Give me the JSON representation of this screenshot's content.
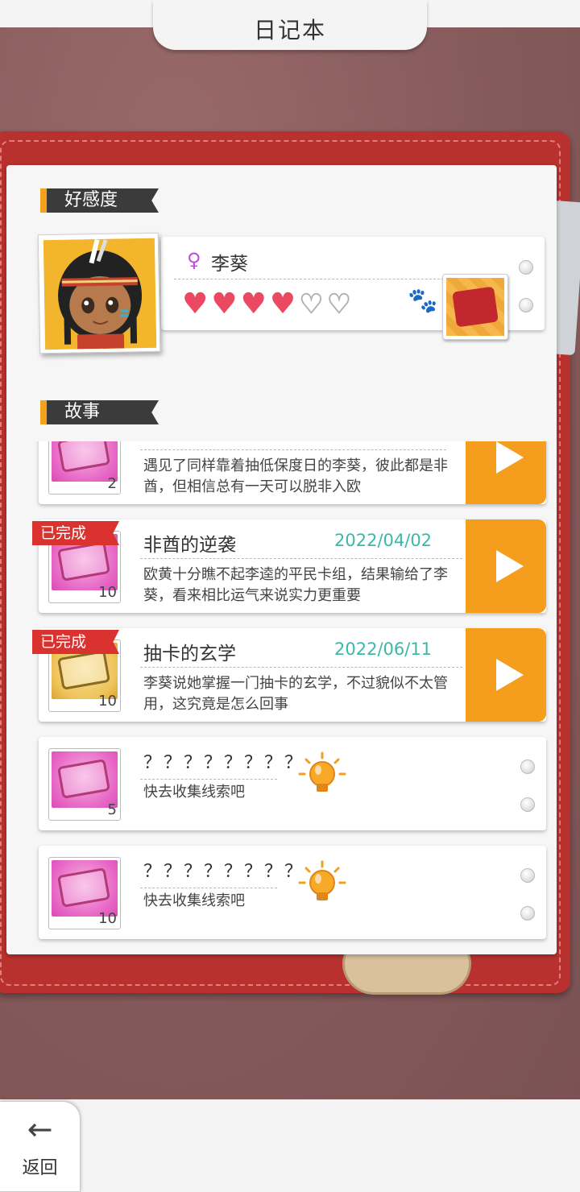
{
  "header": {
    "title": "日记本"
  },
  "affection": {
    "section_label": "好感度",
    "character": {
      "name": "李葵",
      "gender_symbol": "♀"
    },
    "hearts_filled": 4,
    "hearts_total": 6
  },
  "stories": {
    "section_label": "故事",
    "items": [
      {
        "title": "",
        "date": "",
        "desc": "遇见了同样靠着抽低保度日的李葵，彼此都是非酋，但相信总有一天可以脱非入欧",
        "count": "2",
        "completed": false,
        "art": "pink"
      },
      {
        "title": "非酋的逆袭",
        "date": "2022/04/02",
        "desc": "欧黄十分瞧不起李逵的平民卡组，结果输给了李葵，看来相比运气来说实力更重要",
        "count": "10",
        "completed": true,
        "completed_label": "已完成",
        "art": "pink"
      },
      {
        "title": "抽卡的玄学",
        "date": "2022/06/11",
        "desc": "李葵说她掌握一门抽卡的玄学，不过貌似不太管用，这究竟是怎么回事",
        "count": "10",
        "completed": true,
        "completed_label": "已完成",
        "art": "gold"
      },
      {
        "title": "？？？？？？？？",
        "desc": "快去收集线索吧",
        "count": "5",
        "locked": true,
        "art": "pink"
      },
      {
        "title": "？？？？？？？？",
        "desc": "快去收集线索吧",
        "count": "10",
        "locked": true,
        "art": "pink"
      }
    ]
  },
  "footer": {
    "back_label": "返回",
    "back_arrow": "←"
  },
  "colors": {
    "accent_orange": "#f59d1d",
    "date_teal": "#3ab8a8",
    "heart_red": "#ea4961",
    "cover_red": "#b8312f"
  }
}
